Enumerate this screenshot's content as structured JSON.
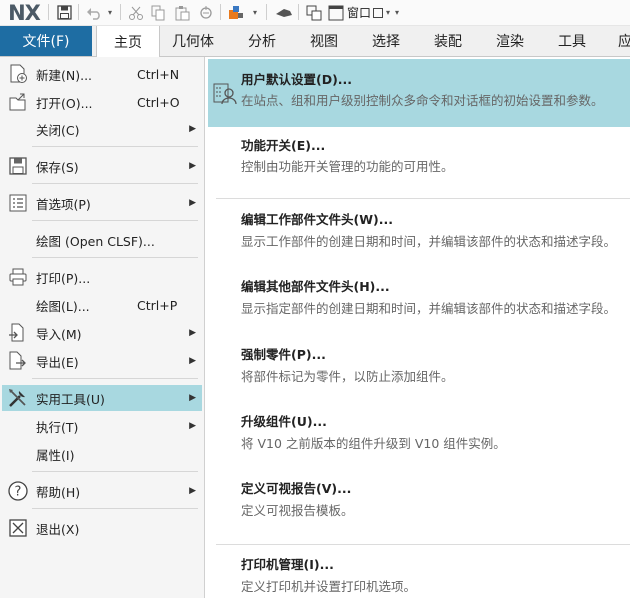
{
  "qat": {
    "logo": "NX",
    "window_label": "窗口"
  },
  "tabs": {
    "file": "文件(F)",
    "items": [
      "主页",
      "几何体",
      "分析",
      "视图",
      "选择",
      "装配",
      "渲染",
      "工具",
      "应"
    ]
  },
  "left_menu": {
    "items": [
      {
        "label": "新建(N)...",
        "shortcut": "Ctrl+N"
      },
      {
        "label": "打开(O)...",
        "shortcut": "Ctrl+O"
      },
      {
        "label": "关闭(C)",
        "shortcut": ""
      },
      {
        "label": "保存(S)",
        "shortcut": ""
      },
      {
        "label": "首选项(P)",
        "shortcut": ""
      },
      {
        "label": "绘图 (Open CLSF)...",
        "shortcut": ""
      },
      {
        "label": "打印(P)...",
        "shortcut": ""
      },
      {
        "label": "绘图(L)...",
        "shortcut": "Ctrl+P"
      },
      {
        "label": "导入(M)",
        "shortcut": ""
      },
      {
        "label": "导出(E)",
        "shortcut": ""
      },
      {
        "label": "实用工具(U)",
        "shortcut": ""
      },
      {
        "label": "执行(T)",
        "shortcut": ""
      },
      {
        "label": "属性(I)",
        "shortcut": ""
      },
      {
        "label": "帮助(H)",
        "shortcut": ""
      },
      {
        "label": "退出(X)",
        "shortcut": ""
      }
    ]
  },
  "submenu": {
    "items": [
      {
        "title": "用户默认设置(D)...",
        "desc": "在站点、组和用户级别控制众多命令和对话框的初始设置和参数。"
      },
      {
        "title": "功能开关(E)...",
        "desc": "控制由功能开关管理的功能的可用性。"
      },
      {
        "title": "编辑工作部件文件头(W)...",
        "desc": "显示工作部件的创建日期和时间，并编辑该部件的状态和描述字段。"
      },
      {
        "title": "编辑其他部件文件头(H)...",
        "desc": "显示指定部件的创建日期和时间，并编辑该部件的状态和描述字段。"
      },
      {
        "title": "强制零件(P)...",
        "desc": "将部件标记为零件，以防止添加组件。"
      },
      {
        "title": "升级组件(U)...",
        "desc": "将 V10 之前版本的组件升级到 V10 组件实例。"
      },
      {
        "title": "定义可视报告(V)...",
        "desc": "定义可视报告模板。"
      },
      {
        "title": "打印机管理(I)...",
        "desc": "定义打印机并设置打印机选项。"
      }
    ]
  },
  "colors": {
    "file_tab": "#1e6da3",
    "highlight": "#a8d8e0",
    "menu_bg": "#f5f5f5"
  },
  "icons": [
    "save-icon",
    "undo-icon",
    "cut-icon",
    "copy-icon",
    "paste-icon",
    "repeat-command-icon",
    "touch-mode-icon",
    "window-icon",
    "new-icon",
    "open-icon",
    "save-icon",
    "preferences-icon",
    "print-icon",
    "import-icon",
    "export-icon",
    "tools-icon",
    "help-icon",
    "exit-icon",
    "user-defaults-icon"
  ]
}
